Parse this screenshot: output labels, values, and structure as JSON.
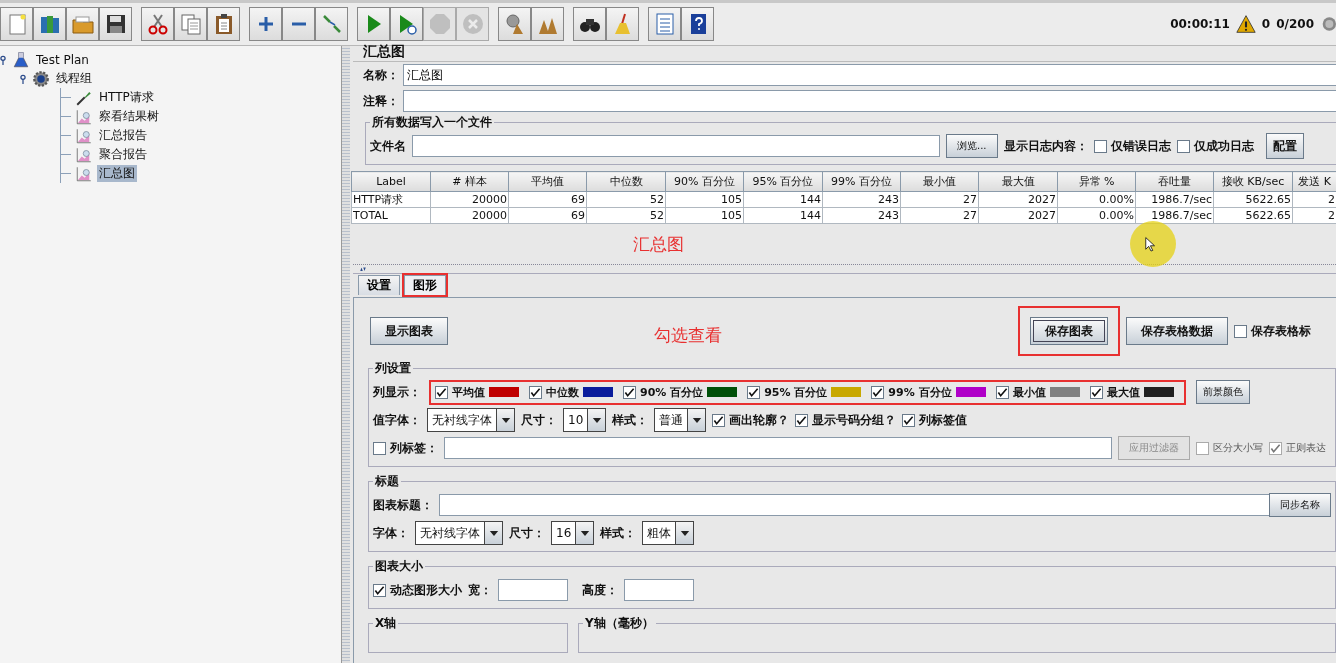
{
  "toolbar": {
    "groups": [
      [
        {
          "kind": "new",
          "disabled": false
        },
        {
          "kind": "templates",
          "disabled": false
        },
        {
          "kind": "open",
          "disabled": false
        },
        {
          "kind": "save",
          "disabled": false
        }
      ],
      [
        {
          "kind": "cut",
          "disabled": false
        },
        {
          "kind": "copy",
          "disabled": false
        },
        {
          "kind": "paste",
          "disabled": false
        }
      ],
      [
        {
          "kind": "expand",
          "disabled": false
        },
        {
          "kind": "collapse",
          "disabled": false
        },
        {
          "kind": "toggle",
          "disabled": false
        }
      ],
      [
        {
          "kind": "start",
          "disabled": false
        },
        {
          "kind": "start_no_pause",
          "disabled": false
        },
        {
          "kind": "stop",
          "disabled": true
        },
        {
          "kind": "shutdown",
          "disabled": true
        }
      ],
      [
        {
          "kind": "clear",
          "disabled": false
        },
        {
          "kind": "clear_all",
          "disabled": false
        }
      ],
      [
        {
          "kind": "search",
          "disabled": false
        },
        {
          "kind": "reset",
          "disabled": false
        }
      ],
      [
        {
          "kind": "functions",
          "disabled": false
        },
        {
          "kind": "help",
          "disabled": false
        }
      ]
    ]
  },
  "status": {
    "elapsed": "00:00:11",
    "warnings": "0",
    "threads": "0/200"
  },
  "tree": [
    {
      "label": "Test Plan",
      "kind": "plan",
      "expanded": true,
      "selected": false,
      "children": [
        {
          "label": "线程组",
          "kind": "thread_group",
          "expanded": true,
          "selected": false,
          "children": [
            {
              "label": "HTTP请求",
              "kind": "sampler",
              "selected": false
            },
            {
              "label": "察看结果树",
              "kind": "listener",
              "selected": false
            },
            {
              "label": "汇总报告",
              "kind": "listener",
              "selected": false
            },
            {
              "label": "聚合报告",
              "kind": "listener",
              "selected": false
            },
            {
              "label": "汇总图",
              "kind": "listener",
              "selected": true
            }
          ]
        }
      ]
    }
  ],
  "panel": {
    "title": "汇总图",
    "name_label": "名称：",
    "name_value": "汇总图",
    "comment_label": "注释：",
    "file_section": {
      "legend": "所有数据写入一个文件",
      "file_label": "文件名",
      "browse": "浏览...",
      "log_label": "显示日志内容：",
      "errors_only": {
        "label": "仅错误日志",
        "checked": false
      },
      "success_only": {
        "label": "仅成功日志",
        "checked": false
      },
      "configure": "配置"
    },
    "table": {
      "columns": [
        "Label",
        "# 样本",
        "平均值",
        "中位数",
        "90% 百分位",
        "95% 百分位",
        "99% 百分位",
        "最小值",
        "最大值",
        "异常 %",
        "吞吐量",
        "接收 KB/sec",
        "发送 K"
      ],
      "rows": [
        [
          "HTTP请求",
          "20000",
          "69",
          "52",
          "105",
          "144",
          "243",
          "27",
          "2027",
          "0.00%",
          "1986.7/sec",
          "5622.65",
          "2"
        ],
        [
          "TOTAL",
          "20000",
          "69",
          "52",
          "105",
          "144",
          "243",
          "27",
          "2027",
          "0.00%",
          "1986.7/sec",
          "5622.65",
          "2"
        ]
      ]
    },
    "table_note": "汇总图",
    "tabs": [
      {
        "label": "设置",
        "selected": false,
        "highlighted": false
      },
      {
        "label": "图形",
        "selected": true,
        "highlighted": true
      }
    ],
    "graph": {
      "display_button": "显示图表",
      "note": "勾选查看",
      "save_graph": {
        "label": "保存图表",
        "highlighted": true
      },
      "save_table": "保存表格数据",
      "save_headers": {
        "label": "保存表格标",
        "checked": false
      },
      "columns_section": {
        "legend": "列设置",
        "display_label": "列显示：",
        "highlighted": true,
        "series": [
          {
            "label": "平均值",
            "checked": true,
            "color": "#c00000"
          },
          {
            "label": "中位数",
            "checked": true,
            "color": "#0a1c9c"
          },
          {
            "label": "90% 百分位",
            "checked": true,
            "color": "#005008"
          },
          {
            "label": "95% 百分位",
            "checked": true,
            "color": "#c8a800"
          },
          {
            "label": "99% 百分位",
            "checked": true,
            "color": "#b000c8"
          },
          {
            "label": "最小值",
            "checked": true,
            "color": "#808080"
          },
          {
            "label": "最大值",
            "checked": true,
            "color": "#202020"
          }
        ],
        "foreground": "前景颜色",
        "value_font_label": "值字体：",
        "value_font": "无衬线字体",
        "size_label": "尺寸：",
        "size": "10",
        "style_label": "样式：",
        "style": "普通",
        "options": [
          {
            "label": "画出轮廓？",
            "checked": true
          },
          {
            "label": "显示号码分组？",
            "checked": true
          },
          {
            "label": "列标签值",
            "checked": true
          }
        ],
        "label_filter": {
          "label": "列标签：",
          "checked": false
        },
        "apply_filter": {
          "label": "应用过滤器",
          "disabled": true
        },
        "case_sensitive": {
          "label": "区分大小写",
          "checked": false,
          "disabled": true
        },
        "regex": {
          "label": "正则表达",
          "checked": true,
          "disabled": true
        }
      },
      "title_section": {
        "legend": "标题",
        "chart_title_label": "图表标题：",
        "sync": "同步名称",
        "font_label": "字体：",
        "font": "无衬线字体",
        "size_label": "尺寸：",
        "size": "16",
        "style_label": "样式：",
        "style": "粗体"
      },
      "size_section": {
        "legend": "图表大小",
        "dynamic": {
          "label": "动态图形大小",
          "checked": true
        },
        "width_label": "宽：",
        "height_label": "高度："
      },
      "axes": [
        {
          "legend": "X轴"
        },
        {
          "legend": "Y轴（毫秒）"
        }
      ]
    }
  },
  "cursor": {
    "highlight": true
  }
}
